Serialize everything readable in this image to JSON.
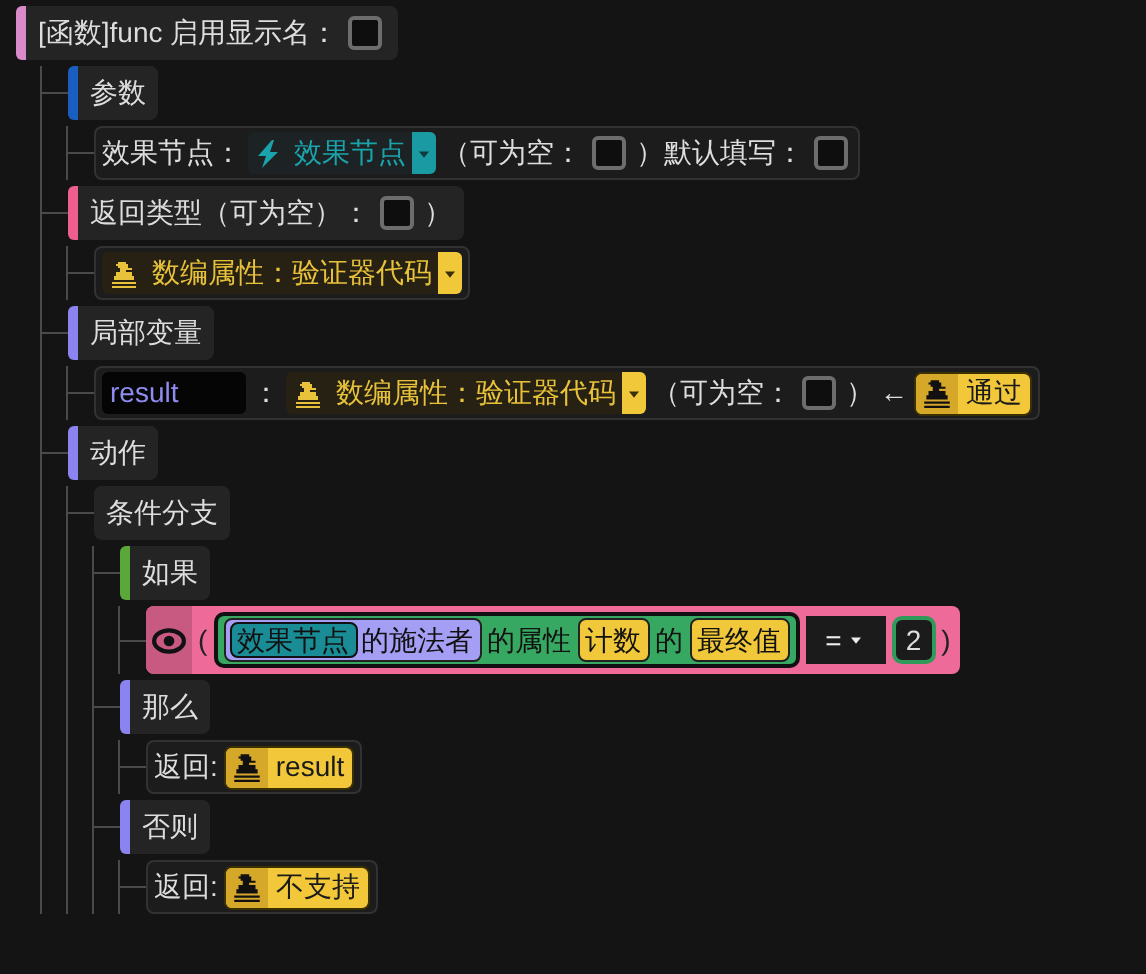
{
  "tree": {
    "kind": "header",
    "color": "#d98ac9",
    "parts": [
      {
        "kind": "text",
        "text": "[函数]func 启用显示名："
      },
      {
        "kind": "checkbox",
        "checked": false
      }
    ],
    "children": [
      {
        "kind": "header",
        "color": "#1a5fc0",
        "parts": [
          {
            "kind": "text",
            "text": "参数"
          }
        ],
        "children": [
          {
            "kind": "row",
            "parts": [
              {
                "kind": "text",
                "text": "效果节点："
              },
              {
                "kind": "node-type",
                "text": "效果节点"
              },
              {
                "kind": "text",
                "text": "（可为空："
              },
              {
                "kind": "checkbox",
                "checked": false
              },
              {
                "kind": "text",
                "text": "）默认填写："
              },
              {
                "kind": "checkbox",
                "checked": false
              }
            ]
          }
        ]
      },
      {
        "kind": "header",
        "color": "#ee5f8f",
        "parts": [
          {
            "kind": "text",
            "text": "返回类型（可为空）："
          },
          {
            "kind": "checkbox",
            "checked": false
          },
          {
            "kind": "text",
            "text": "）"
          }
        ],
        "children": [
          {
            "kind": "row",
            "parts": [
              {
                "kind": "data-type",
                "text": "数编属性：验证器代码"
              }
            ]
          }
        ]
      },
      {
        "kind": "header",
        "color": "#8b84f0",
        "parts": [
          {
            "kind": "text",
            "text": "局部变量"
          }
        ],
        "children": [
          {
            "kind": "row",
            "parts": [
              {
                "kind": "field",
                "value": "result"
              },
              {
                "kind": "text",
                "text": "："
              },
              {
                "kind": "data-type",
                "text": "数编属性：验证器代码"
              },
              {
                "kind": "text",
                "text": "（可为空："
              },
              {
                "kind": "checkbox",
                "checked": false
              },
              {
                "kind": "text",
                "text": "）"
              },
              {
                "kind": "text",
                "text": "←"
              },
              {
                "kind": "value",
                "text": "通过"
              }
            ]
          }
        ]
      },
      {
        "kind": "header",
        "color": "#8b84f0",
        "parts": [
          {
            "kind": "text",
            "text": "动作"
          }
        ],
        "children": [
          {
            "kind": "plain",
            "parts": [
              {
                "kind": "text",
                "text": "条件分支"
              }
            ],
            "children": [
              {
                "kind": "header",
                "color": "#5aa83a",
                "parts": [
                  {
                    "kind": "text",
                    "text": "如果"
                  }
                ],
                "children": [
                  {
                    "kind": "condition",
                    "open": "(",
                    "subject": "效果节点",
                    "owner": "的施法者",
                    "attr_prefix": "的属性",
                    "attr": "计数",
                    "of": "的",
                    "final": "最终值",
                    "operator": "=",
                    "operand": "2",
                    "close": ")"
                  }
                ]
              },
              {
                "kind": "header",
                "color": "#8b84f0",
                "parts": [
                  {
                    "kind": "text",
                    "text": "那么"
                  }
                ],
                "children": [
                  {
                    "kind": "row",
                    "parts": [
                      {
                        "kind": "text",
                        "text": "返回:"
                      },
                      {
                        "kind": "value",
                        "text": "result"
                      }
                    ]
                  }
                ]
              },
              {
                "kind": "header",
                "color": "#8b84f0",
                "parts": [
                  {
                    "kind": "text",
                    "text": "否则"
                  }
                ],
                "children": [
                  {
                    "kind": "row",
                    "parts": [
                      {
                        "kind": "text",
                        "text": "返回:"
                      },
                      {
                        "kind": "value",
                        "text": "不支持"
                      }
                    ]
                  }
                ]
              }
            ]
          }
        ]
      }
    ]
  }
}
